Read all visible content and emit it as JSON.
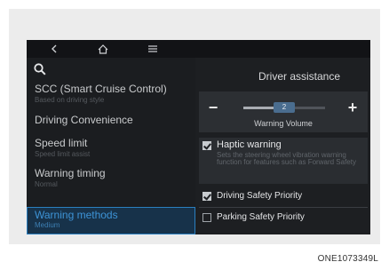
{
  "nav": {
    "icons": [
      "back-icon",
      "home-icon",
      "menu-icon"
    ]
  },
  "left_panel": {
    "search_icon": "search-icon",
    "items": [
      {
        "title": "SCC (Smart Cruise Control)",
        "subtitle": "Based on driving style"
      },
      {
        "title": "Driving Convenience",
        "subtitle": ""
      },
      {
        "title": "Speed limit",
        "subtitle": "Speed limit assist"
      },
      {
        "title": "Warning timing",
        "subtitle": "Normal"
      },
      {
        "title": "Warning methods",
        "subtitle": "Medium",
        "selected": true
      }
    ]
  },
  "right_panel": {
    "title": "Driver assistance",
    "volume": {
      "minus_label": "−",
      "plus_label": "+",
      "value": "2",
      "level_fraction": 0.5,
      "label": "Warning Volume"
    },
    "options": {
      "haptic": {
        "label": "Haptic warning",
        "checked": true,
        "description": "Sets the steering wheel vibration warning function for features such as Forward Safety"
      },
      "driving_safety": {
        "label": "Driving Safety Priority",
        "checked": true
      },
      "parking_safety": {
        "label": "Parking Safety Priority",
        "checked": false
      }
    }
  },
  "caption": "ONE1073349L",
  "colors": {
    "accent": "#2b7fbf",
    "screen_bg": "#1d1f22",
    "frame_bg": "#ececec"
  }
}
